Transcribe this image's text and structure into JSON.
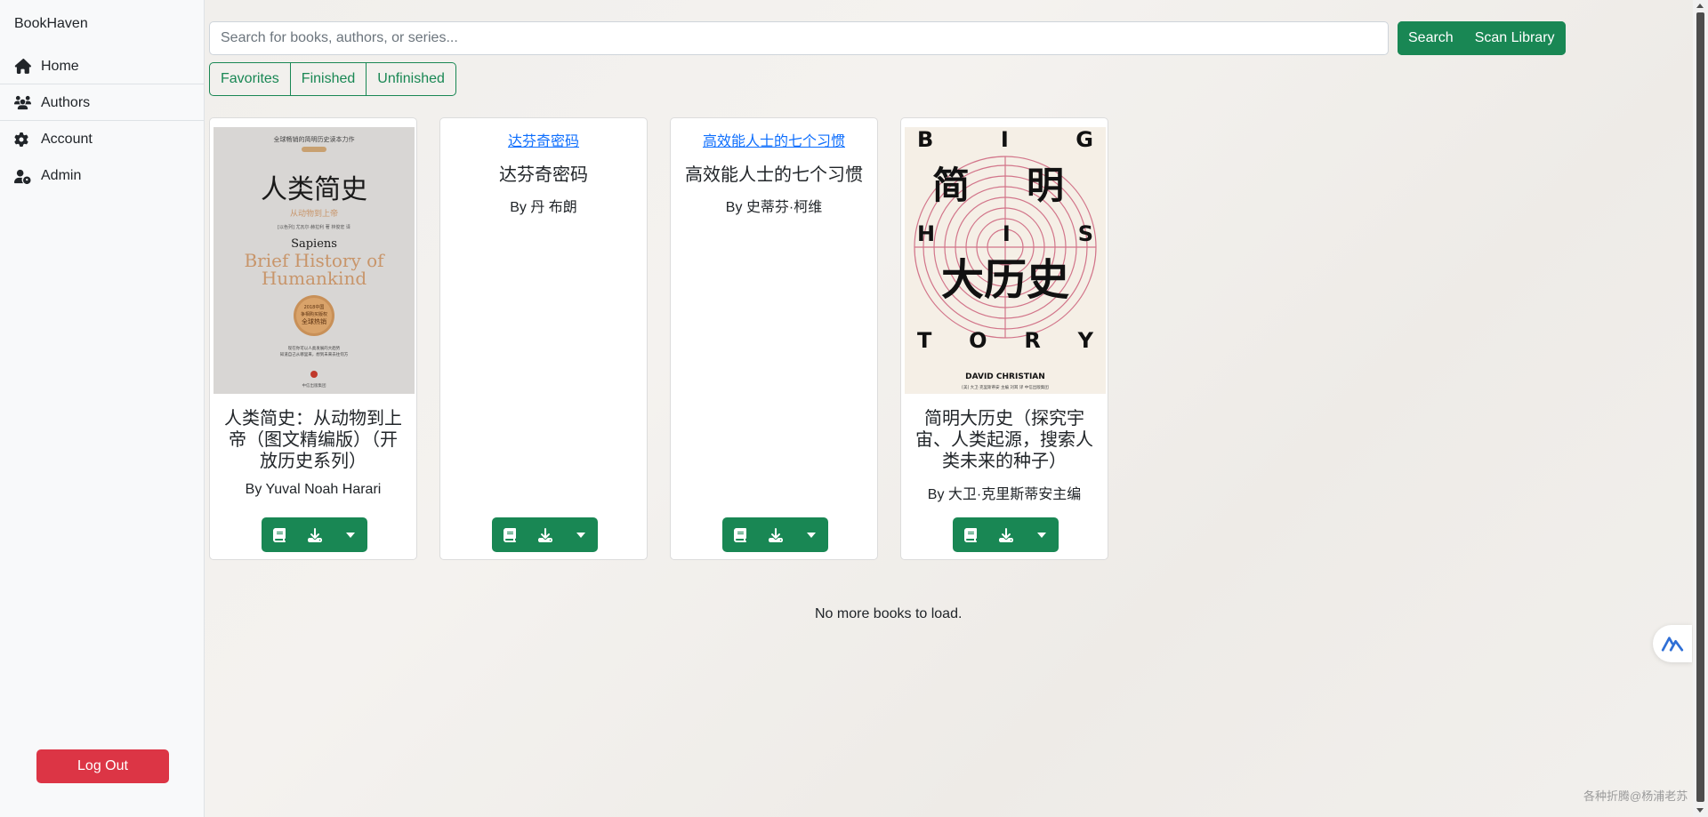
{
  "sidebar": {
    "brand": "BookHaven",
    "items": [
      {
        "label": "Home",
        "icon": "home-icon"
      },
      {
        "label": "Authors",
        "icon": "users-icon"
      },
      {
        "label": "Account",
        "icon": "gear-icon"
      },
      {
        "label": "Admin",
        "icon": "user-cog-icon"
      }
    ],
    "logout_label": "Log Out"
  },
  "search": {
    "placeholder": "Search for books, authors, or series...",
    "value": "",
    "search_label": "Search",
    "scan_label": "Scan Library"
  },
  "filters": [
    "Favorites",
    "Finished",
    "Unfinished"
  ],
  "books": [
    {
      "title": "人类简史：从动物到上帝（图文精编版）（开放历史系列）",
      "author": "By Yuval Noah Harari",
      "cover": {
        "top_text": "全球畅销的简明历史读本力作",
        "title_cn": "人类简史",
        "subtitle_cn": "从动物到上帝",
        "author_line": "[以色列] 尤瓦尔·赫拉利 著  林俊宏 译",
        "title_en_1": "Sapiens",
        "title_en_2": "Brief History of",
        "title_en_3": "Humankind",
        "badge_1": "2018中国",
        "badge_2": "争相购买版权",
        "badge_3": "全球热销",
        "footer_1": "现在你可以人类发展的大趋势",
        "footer_2": "知道自己从哪里来，想到未来去往何方",
        "publisher": "中信出版集团"
      }
    },
    {
      "title": "达芬奇密码",
      "author": "By 丹 布朗",
      "image_alt": "达芬奇密码"
    },
    {
      "title": "高效能人士的七个习惯",
      "author": "By 史蒂芬·柯维",
      "image_alt": "高效能人士的七个习惯"
    },
    {
      "title": "简明大历史（探究宇宙、人类起源，搜索人类未来的种子）",
      "author": "By 大卫·克里斯蒂安主编",
      "cover": {
        "big": "B I G",
        "his": "H I S",
        "tory": "T O R Y",
        "cn_1": "简",
        "cn_2": "明",
        "cn_3": "大历史",
        "author_en": "DAVID CHRISTIAN",
        "credits": "[美] 大卫·克里斯蒂安 主编  刘耳 译  中信出版集团"
      }
    }
  ],
  "status": {
    "no_more": "No more books to load."
  },
  "watermark": "各种折腾@杨浦老苏",
  "colors": {
    "accent": "#198754",
    "danger": "#dc3545",
    "link": "#0d6efd",
    "sidebar_bg": "#f8f9fa"
  }
}
